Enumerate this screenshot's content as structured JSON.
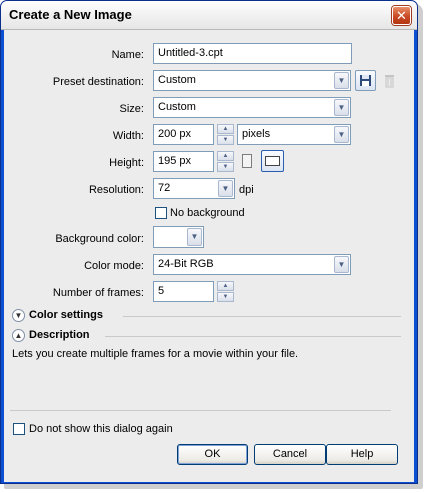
{
  "window": {
    "title": "Create a New Image"
  },
  "form": {
    "name_label": "Name:",
    "name_value": "Untitled-3.cpt",
    "preset_label": "Preset destination:",
    "preset_value": "Custom",
    "size_label": "Size:",
    "size_value": "Custom",
    "width_label": "Width:",
    "width_value": "200 px",
    "width_units": "pixels",
    "height_label": "Height:",
    "height_value": "195 px",
    "resolution_label": "Resolution:",
    "resolution_value": "72",
    "resolution_unit": "dpi",
    "no_background_label": "No background",
    "background_color_label": "Background color:",
    "color_mode_label": "Color mode:",
    "color_mode_value": "24-Bit RGB",
    "frames_label": "Number of frames:",
    "frames_value": "5"
  },
  "sections": {
    "color_settings": "Color settings",
    "description": "Description",
    "description_text": "Lets you create multiple frames for a movie within your file."
  },
  "footer": {
    "dont_show_label": "Do not show this dialog again",
    "ok": "OK",
    "cancel": "Cancel",
    "help": "Help"
  },
  "icons": {
    "close": "close-icon",
    "save_preset": "floppy-disk-icon",
    "delete_preset": "trash-icon",
    "portrait": "portrait-orientation-icon",
    "landscape": "landscape-orientation-icon"
  },
  "colors": {
    "title_bar_border": "#0b2f8c",
    "dialog_bg": "#ececec",
    "field_border": "#7f9db9"
  }
}
